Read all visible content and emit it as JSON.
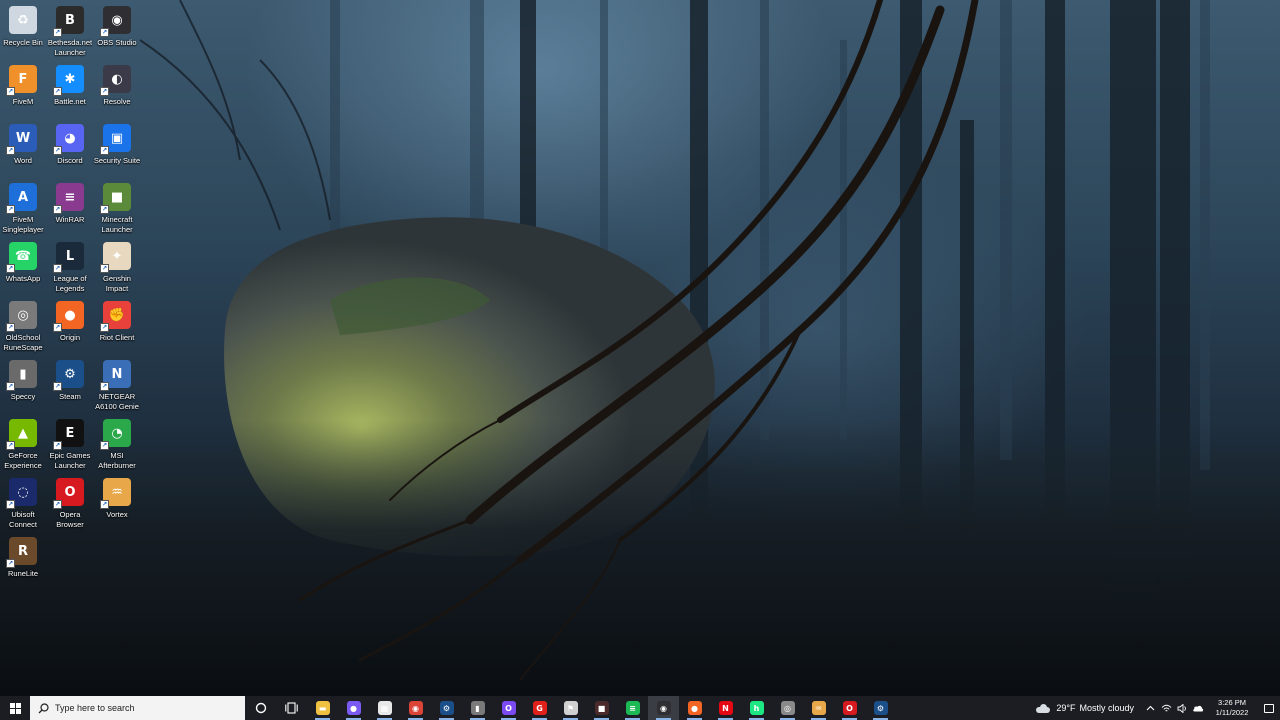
{
  "desktop": {
    "icons": [
      {
        "label": "Recycle Bin",
        "icon": "recycle-bin-icon",
        "color": "#cfd8e0"
      },
      {
        "label": "Bethesda.net\nLauncher",
        "icon": "bethesda-icon",
        "color": "#2b2b2b"
      },
      {
        "label": "OBS Studio",
        "icon": "obs-icon",
        "color": "#2e2e33"
      },
      {
        "label": "FiveM",
        "icon": "fivem-icon",
        "color": "#f0902a"
      },
      {
        "label": "Battle.net",
        "icon": "battlenet-icon",
        "color": "#148eff"
      },
      {
        "label": "Resolve",
        "icon": "resolve-icon",
        "color": "#3a3a48"
      },
      {
        "label": "Word",
        "icon": "word-icon",
        "color": "#2b5cb8"
      },
      {
        "label": "Discord",
        "icon": "discord-icon",
        "color": "#5865f2"
      },
      {
        "label": "Security Suite",
        "icon": "security-suite-icon",
        "color": "#1a73e8"
      },
      {
        "label": "FiveM\nSingleplayer",
        "icon": "fivem-singleplayer-icon",
        "color": "#1e6fd9"
      },
      {
        "label": "WinRAR",
        "icon": "winrar-icon",
        "color": "#8a3a8f"
      },
      {
        "label": "Minecraft\nLauncher",
        "icon": "minecraft-icon",
        "color": "#5a8a3a"
      },
      {
        "label": "WhatsApp",
        "icon": "whatsapp-icon",
        "color": "#25d366"
      },
      {
        "label": "League of\nLegends",
        "icon": "league-icon",
        "color": "#1a2a3a"
      },
      {
        "label": "Genshin\nImpact",
        "icon": "genshin-icon",
        "color": "#e8d8c0"
      },
      {
        "label": "OldSchool\nRuneScape",
        "icon": "runescape-icon",
        "color": "#7a7a7a"
      },
      {
        "label": "Origin",
        "icon": "origin-icon",
        "color": "#f26522"
      },
      {
        "label": "Riot Client",
        "icon": "riot-icon",
        "color": "#e8413b"
      },
      {
        "label": "Speccy",
        "icon": "speccy-icon",
        "color": "#6a6a6a"
      },
      {
        "label": "Steam",
        "icon": "steam-icon",
        "color": "#1b4f8a"
      },
      {
        "label": "NETGEAR\nA6100 Genie",
        "icon": "netgear-icon",
        "color": "#3a6fb8"
      },
      {
        "label": "GeForce\nExperience",
        "icon": "geforce-icon",
        "color": "#76b900"
      },
      {
        "label": "Epic Games\nLauncher",
        "icon": "epic-icon",
        "color": "#111111"
      },
      {
        "label": "MSI\nAfterburner",
        "icon": "msi-afterburner-icon",
        "color": "#2aa84a"
      },
      {
        "label": "Ubisoft\nConnect",
        "icon": "ubisoft-icon",
        "color": "#1a2a6a"
      },
      {
        "label": "Opera\nBrowser",
        "icon": "opera-icon",
        "color": "#d61a1f"
      },
      {
        "label": "Vortex",
        "icon": "vortex-icon",
        "color": "#e8a84a"
      },
      {
        "label": "RuneLite",
        "icon": "runelite-icon",
        "color": "#6a4a2a"
      }
    ]
  },
  "taskbar": {
    "search_placeholder": "Type here to search",
    "apps": [
      {
        "icon": "file-explorer-icon",
        "color": "#f0c040"
      },
      {
        "icon": "messenger-icon",
        "color": "#7a5af0"
      },
      {
        "icon": "store-icon",
        "color": "#e8e8e8"
      },
      {
        "icon": "chrome-icon",
        "color": "#db4437"
      },
      {
        "icon": "steam-icon",
        "color": "#1b4f8a"
      },
      {
        "icon": "speccy-icon",
        "color": "#7a7a7a"
      },
      {
        "icon": "opera-gx-icon",
        "color": "#7a4af0"
      },
      {
        "icon": "garena-icon",
        "color": "#e0201a"
      },
      {
        "icon": "corsair-icon",
        "color": "#d0d0d0"
      },
      {
        "icon": "app-icon",
        "color": "#4a2a2a"
      },
      {
        "icon": "spotify-icon",
        "color": "#1db954"
      },
      {
        "icon": "obs-icon",
        "color": "#2e2e33"
      },
      {
        "icon": "origin-icon",
        "color": "#f26522"
      },
      {
        "icon": "netflix-icon",
        "color": "#e50914"
      },
      {
        "icon": "hulu-icon",
        "color": "#1ce783"
      },
      {
        "icon": "runescape-icon",
        "color": "#8a8a8a"
      },
      {
        "icon": "vortex-icon",
        "color": "#e8a84a"
      },
      {
        "icon": "opera-icon",
        "color": "#d61a1f"
      },
      {
        "icon": "steam-icon",
        "color": "#1b4f8a"
      }
    ],
    "active_app_index": 11,
    "weather": {
      "temperature": "29°F",
      "condition": "Mostly cloudy"
    },
    "clock": {
      "time": "3:26 PM",
      "date": "1/11/2022"
    }
  }
}
